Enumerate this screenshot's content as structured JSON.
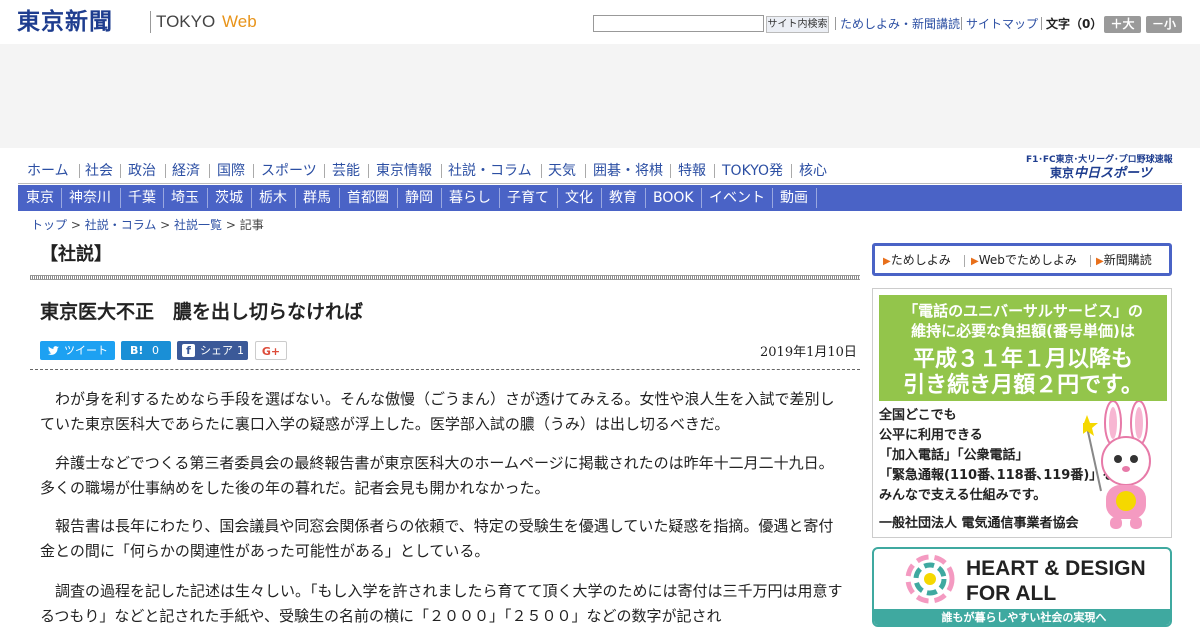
{
  "header": {
    "logo_main": "東京新聞",
    "logo_tokyo": "TOKYO",
    "logo_web": "Web",
    "search_button": "サイト内検索",
    "links": [
      "ためしよみ・新聞講読",
      "サイトマップ"
    ],
    "moji_label": "文字（0）",
    "size_up": "＋大",
    "size_down": "－小"
  },
  "main_nav": [
    "ホーム",
    "社会",
    "政治",
    "経済",
    "国際",
    "スポーツ",
    "芸能",
    "東京情報",
    "社説・コラム",
    "天気",
    "囲碁・将棋",
    "特報",
    "TOKYO発",
    "核心"
  ],
  "chunichi": {
    "top_text": "F1･FC東京･大リーグ･プロ野球速報",
    "logo_prefix": "東京",
    "logo_main": "中日スポーツ"
  },
  "region_nav": [
    "東京",
    "神奈川",
    "千葉",
    "埼玉",
    "茨城",
    "栃木",
    "群馬",
    "首都圏",
    "静岡",
    "暮らし",
    "子育て",
    "文化",
    "教育",
    "BOOK",
    "イベント",
    "動画"
  ],
  "breadcrumb": {
    "items": [
      "トップ",
      "社説・コラム",
      "社説一覧"
    ],
    "current": "記事",
    "separator": " > "
  },
  "article": {
    "section": "【社説】",
    "title": "東京医大不正　膿を出し切らなければ",
    "date": "2019年1月10日",
    "paragraphs": [
      "わが身を利するためなら手段を選ばない。そんな傲慢（ごうまん）さが透けてみえる。女性や浪人生を入試で差別していた東京医科大であらたに裏口入学の疑惑が浮上した。医学部入試の膿（うみ）は出し切るべきだ。",
      "弁護士などでつくる第三者委員会の最終報告書が東京医科大のホームページに掲載されたのは昨年十二月二十九日。多くの職場が仕事納めをした後の年の暮れだ。記者会見も開かれなかった。",
      "報告書は長年にわたり、国会議員や同窓会関係者らの依頼で、特定の受験生を優遇していた疑惑を指摘。優遇と寄付金との間に「何らかの関連性があった可能性がある」としている。",
      "調査の過程を記した記述は生々しい。「もし入学を許されましたら育てて頂く大学のためには寄付は三千万円は用意するつもり」などと記された手紙や、受験生の名前の横に「２０００」「２５００」などの数字が記され"
    ]
  },
  "share": {
    "tweet_icon": "twitter-bird-icon",
    "tweet_label": "ツイート",
    "hatena_icon": "B!",
    "hatena_count": "0",
    "fb_icon": "f",
    "fb_label": "シェア",
    "fb_count": "1",
    "gplus": "G+"
  },
  "promo": [
    "ためしよみ",
    "Webでためしよみ",
    "新聞購読"
  ],
  "ad_universal": {
    "line1": "「電話のユニバーサルサービス」の",
    "line2": "維持に必要な負担額(番号単価)は",
    "head1": "平成３１年１月以降も",
    "head2": "引き続き月額２円です。",
    "body": [
      "全国どこでも",
      "公平に利用できる",
      "「加入電話」「公衆電話」",
      "「緊急通報(110番､118番､119番)」を",
      "みんなで支える仕組みです。"
    ],
    "footer": "一般社団法人 電気通信事業者協会",
    "colors": {
      "green": "#93c54b",
      "pink": "#f49ac1",
      "yellow": "#f5d800"
    }
  },
  "ad_heart": {
    "line1": "HEART & DESIGN",
    "line2": "FOR ALL",
    "bar": "誰もが暮らしやすい社会の実現へ",
    "accent": "#3fa9a0"
  },
  "colors": {
    "brand_blue": "#1e3d8f",
    "nav_blue": "#4a63c6",
    "link_blue": "#2c4fa3",
    "web_orange": "#e8941a"
  }
}
